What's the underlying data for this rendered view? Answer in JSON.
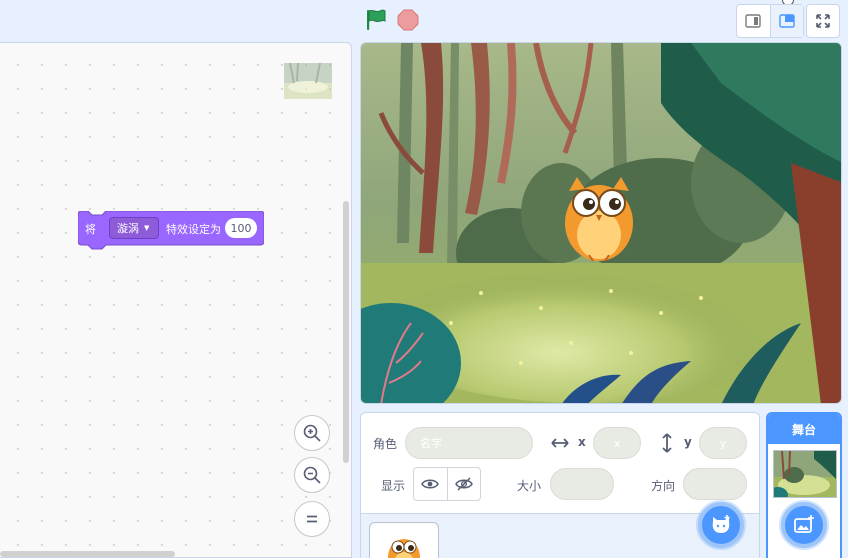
{
  "block": {
    "prefix": "将",
    "effect": "漩涡",
    "middle": "特效设定为",
    "value": "100"
  },
  "sprite_info": {
    "sprite_label": "角色",
    "name_placeholder": "名字",
    "x_label": "x",
    "x_placeholder": "x",
    "y_label": "y",
    "y_placeholder": "y",
    "show_label": "显示",
    "size_label": "大小",
    "direction_label": "方向"
  },
  "stage_panel": {
    "title": "舞台"
  },
  "colors": {
    "motion_block": "#9966ff",
    "accent": "#4c97ff",
    "flag": "#2ca05a",
    "stop": "#ec9c9c"
  },
  "icons": [
    "green-flag-icon",
    "stop-icon",
    "small-stage-icon",
    "normal-stage-icon",
    "fullscreen-icon",
    "zoom-in-icon",
    "zoom-out-icon",
    "zoom-reset-icon",
    "eye-icon",
    "eye-slash-icon",
    "choose-sprite-icon",
    "choose-backdrop-icon"
  ]
}
